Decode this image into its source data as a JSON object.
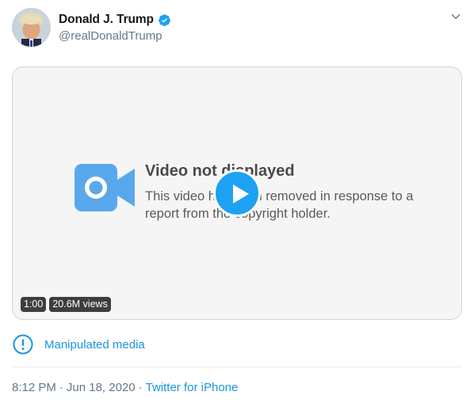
{
  "author": {
    "display_name": "Donald J. Trump",
    "handle": "@realDonaldTrump",
    "verified": true
  },
  "header": {
    "more_icon": "chevron-down-icon"
  },
  "media": {
    "notice_title": "Video not displayed",
    "notice_body": "This video has been removed in response to a report from the copyright holder.",
    "duration": "1:00",
    "views": "20.6M views",
    "notice_icon": "video-camera-icon",
    "play_icon": "play-icon"
  },
  "manipulated": {
    "label": "Manipulated media",
    "icon": "exclamation-circle-icon"
  },
  "meta": {
    "time": "8:12 PM",
    "date": "Jun 18, 2020",
    "separator": "·",
    "source": "Twitter for iPhone"
  },
  "colors": {
    "accent": "#1da1f2",
    "link": "#1b95e0",
    "secondary_text": "#657786",
    "notice_icon": "#5aa8ec"
  }
}
